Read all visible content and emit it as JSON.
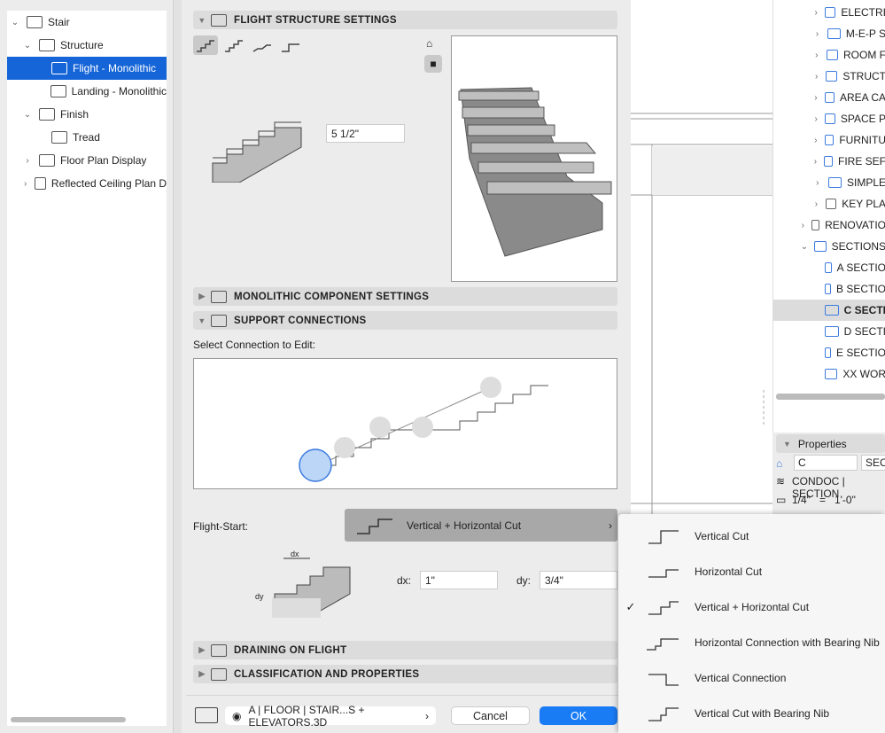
{
  "tree": [
    {
      "label": "Stair",
      "level": 0,
      "exp": "down"
    },
    {
      "label": "Structure",
      "level": 1,
      "exp": "down"
    },
    {
      "label": "Flight - Monolithic",
      "level": 2,
      "selected": true
    },
    {
      "label": "Landing - Monolithic",
      "level": 2
    },
    {
      "label": "Finish",
      "level": 1,
      "exp": "down"
    },
    {
      "label": "Tread",
      "level": 2
    },
    {
      "label": "Floor Plan Display",
      "level": 1,
      "exp": "right"
    },
    {
      "label": "Reflected Ceiling Plan D",
      "level": 1,
      "exp": "right"
    }
  ],
  "sections": {
    "flight": "FLIGHT STRUCTURE SETTINGS",
    "monolithic": "MONOLITHIC COMPONENT SETTINGS",
    "support": "SUPPORT CONNECTIONS",
    "draining": "DRAINING ON FLIGHT",
    "classification": "CLASSIFICATION AND PROPERTIES"
  },
  "flight": {
    "thickness": "5 1/2\""
  },
  "support": {
    "select_label": "Select Connection to Edit:",
    "flight_start_label": "Flight-Start:",
    "flight_start_value": "Vertical + Horizontal Cut",
    "dx_label": "dx:",
    "dx": "1\"",
    "dy_label": "dy:",
    "dy": "3/4\"",
    "diagram_dx": "dx",
    "diagram_dy": "dy"
  },
  "menu": [
    {
      "label": "Vertical Cut",
      "checked": false
    },
    {
      "label": "Horizontal Cut",
      "checked": false
    },
    {
      "label": "Vertical + Horizontal Cut",
      "checked": true
    },
    {
      "label": "Horizontal Connection with Bearing Nib",
      "checked": false
    },
    {
      "label": "Vertical Connection",
      "checked": false
    },
    {
      "label": "Vertical Cut with Bearing Nib",
      "checked": false
    }
  ],
  "check_mark": "✓",
  "footer": {
    "layer": "A | FLOOR | STAIR...S + ELEVATORS.3D",
    "cancel": "Cancel",
    "ok": "OK"
  },
  "navigator": [
    {
      "label": "ELECTRI",
      "ind": 1
    },
    {
      "label": "M-E-P S",
      "ind": 1
    },
    {
      "label": "ROOM F",
      "ind": 1
    },
    {
      "label": "STRUCT",
      "ind": 1
    },
    {
      "label": "AREA CA",
      "ind": 1
    },
    {
      "label": "SPACE P",
      "ind": 1
    },
    {
      "label": "FURNITU",
      "ind": 1
    },
    {
      "label": "FIRE SEF",
      "ind": 1
    },
    {
      "label": "SIMPLE",
      "ind": 1
    },
    {
      "label": "KEY PLA",
      "ind": 1,
      "gray": true
    },
    {
      "label": "RENOVATIO",
      "ind": 0,
      "gray": true
    },
    {
      "label": "SECTIONS",
      "ind": 0,
      "open": true
    },
    {
      "label": "A SECTIO",
      "ind": 2
    },
    {
      "label": "B SECTIO",
      "ind": 2
    },
    {
      "label": "C SECTI",
      "ind": 2,
      "selected": true
    },
    {
      "label": "D SECTI",
      "ind": 2
    },
    {
      "label": "E SECTIO",
      "ind": 2
    },
    {
      "label": "XX WOR",
      "ind": 2
    }
  ],
  "properties": {
    "title": "Properties",
    "id": "C",
    "type": "SECT",
    "layer": "CONDOC | SECTION",
    "scale": "1/4\"   =   1'-0\""
  }
}
